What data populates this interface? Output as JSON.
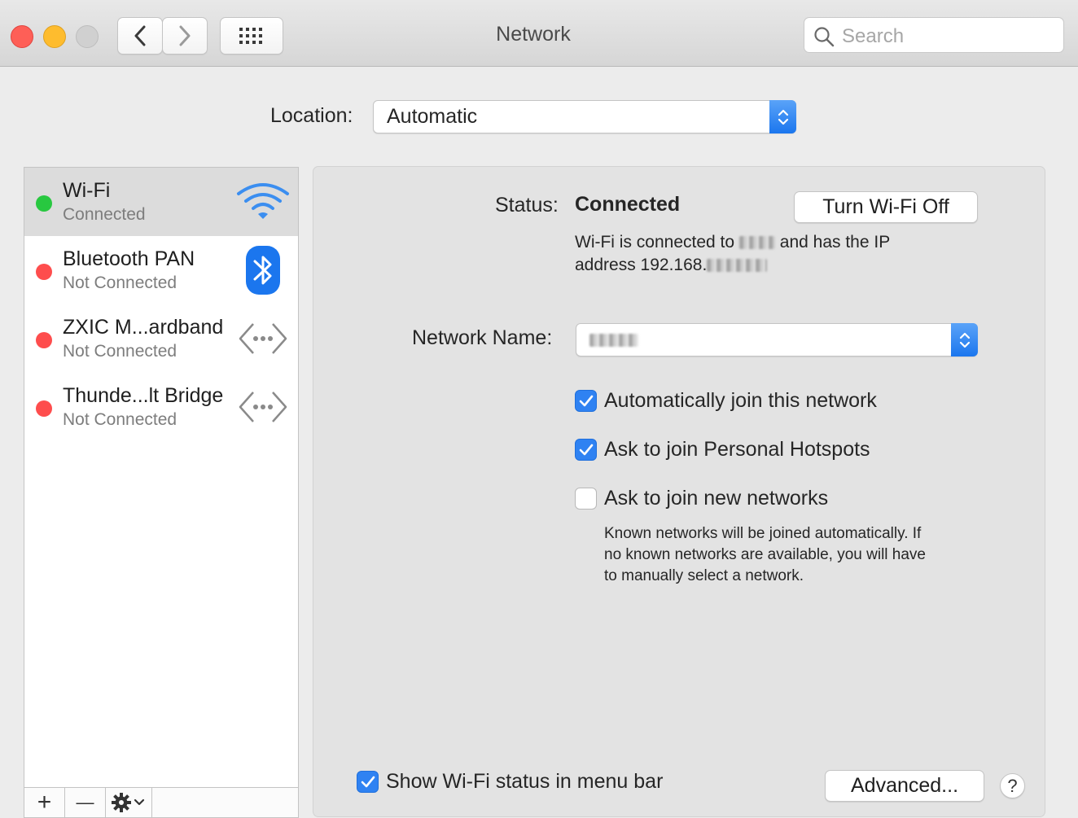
{
  "window": {
    "title": "Network",
    "search_placeholder": "Search"
  },
  "location": {
    "label": "Location:",
    "value": "Automatic"
  },
  "services": [
    {
      "name": "Wi-Fi",
      "status": "Connected",
      "status_color": "#28c840",
      "icon": "wifi-icon",
      "selected": true
    },
    {
      "name": "Bluetooth PAN",
      "status": "Not Connected",
      "status_color": "#fe4d4d",
      "icon": "bluetooth-icon",
      "selected": false
    },
    {
      "name": "ZXIC M...ardband",
      "status": "Not Connected",
      "status_color": "#fe4d4d",
      "icon": "ethernet-icon",
      "selected": false
    },
    {
      "name": "Thunde...lt Bridge",
      "status": "Not Connected",
      "status_color": "#fe4d4d",
      "icon": "ethernet-icon",
      "selected": false
    }
  ],
  "sidebar_toolbar": {
    "add": "+",
    "remove": "—"
  },
  "detail": {
    "status_label": "Status:",
    "status_value": "Connected",
    "turn_off_button": "Turn Wi-Fi Off",
    "desc_part1": "Wi-Fi is connected to",
    "desc_part2": "and has the IP",
    "desc_part3": "address 192.168.",
    "network_name_label": "Network Name:",
    "options": [
      {
        "label": "Automatically join this network",
        "checked": true
      },
      {
        "label": "Ask to join Personal Hotspots",
        "checked": true
      },
      {
        "label": "Ask to join new networks",
        "checked": false
      }
    ],
    "known_networks_note_line1": "Known networks will be joined automatically. If",
    "known_networks_note_line2": "no known networks are available, you will have",
    "known_networks_note_line3": "to manually select a network.",
    "show_status_label": "Show Wi-Fi status in menu bar",
    "show_status_checked": true,
    "advanced_button": "Advanced...",
    "help_button": "?"
  },
  "colors": {
    "accent": "#2f82f2",
    "connected": "#28c840",
    "disconnected": "#fe4d4d",
    "wifi_icon": "#3b8ef0",
    "bluetooth": "#1b76ee"
  }
}
